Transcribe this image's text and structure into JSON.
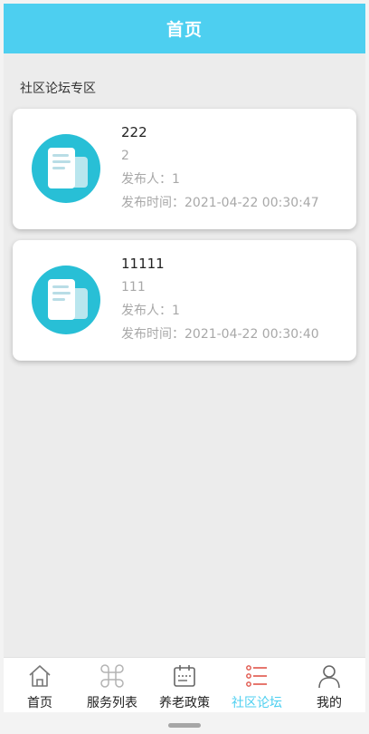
{
  "header": {
    "title": "首页"
  },
  "section": {
    "title": "社区论坛专区"
  },
  "posts": [
    {
      "title": "222",
      "content": "2",
      "publisher": "发布人：1",
      "time": "发布时间：2021-04-22 00:30:47",
      "icon": "document-icon"
    },
    {
      "title": "11111",
      "content": "111",
      "publisher": "发布人：1",
      "time": "发布时间：2021-04-22 00:30:40",
      "icon": "document-icon"
    }
  ],
  "tabbar": {
    "active_color": "#4dcff0",
    "items": [
      {
        "label": "首页",
        "icon": "home-icon",
        "active": false
      },
      {
        "label": "服务列表",
        "icon": "command-icon",
        "active": false
      },
      {
        "label": "养老政策",
        "icon": "calendar-icon",
        "active": false
      },
      {
        "label": "社区论坛",
        "icon": "list-icon",
        "active": true
      },
      {
        "label": "我的",
        "icon": "user-icon",
        "active": false
      }
    ]
  },
  "colors": {
    "header": "#4dcff0",
    "icon_bg": "#28bfd6",
    "list_icon": "#e0554a"
  }
}
